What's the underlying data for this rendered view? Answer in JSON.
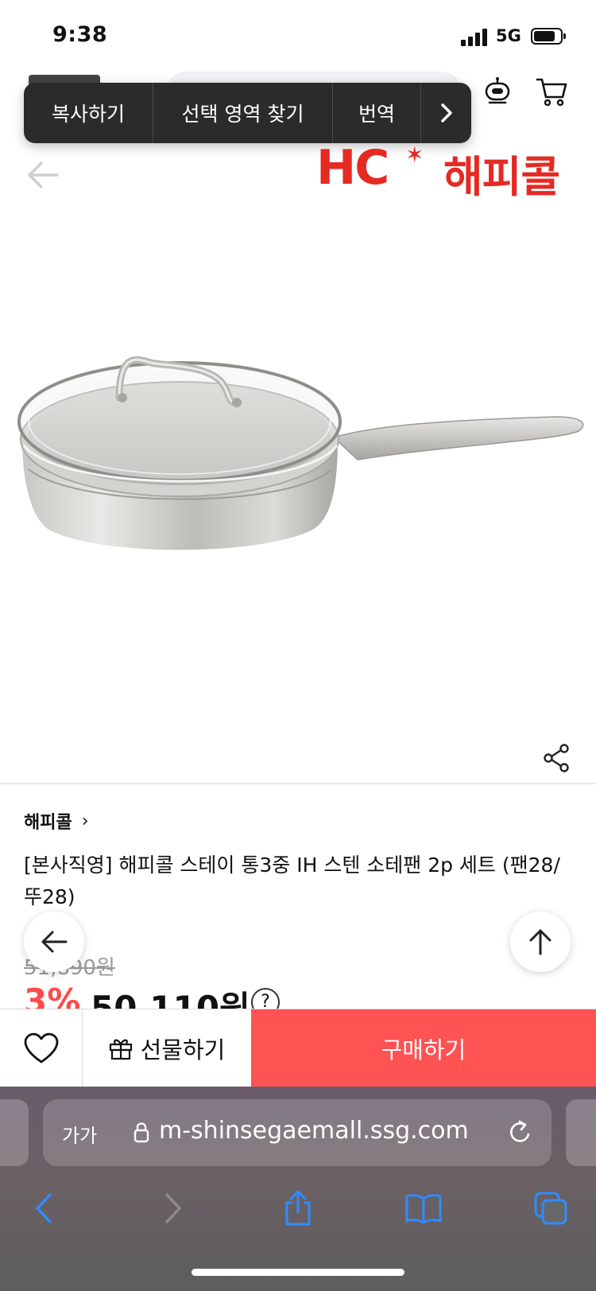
{
  "status_bar": {
    "time": "9:38",
    "network": "5G"
  },
  "edit_menu": {
    "copy": "복사하기",
    "find_in_selection": "선택 영역 찾기",
    "translate": "번역",
    "more": "›"
  },
  "brand_logo": {
    "letters": "HC",
    "name": "해피콜",
    "color": "#e52a23"
  },
  "product": {
    "brand": "해피콜",
    "brand_chevron": "›",
    "title": "[본사직영] 해피콜 스테이 통3중 IH 스텐 소테팬 2p 세트 (팬28/뚜28)",
    "original_price": "51,890원",
    "discount": "3%",
    "sale_price": "50,110원",
    "help": "?"
  },
  "actions": {
    "gift": "선물하기",
    "buy": "구매하기",
    "buy_color": "#ff5252"
  },
  "browser": {
    "text_size": "가가",
    "url": "m-shinsegaemall.ssg.com"
  },
  "icons": [
    "signal-icon",
    "battery-icon",
    "bot-icon",
    "cart-icon",
    "back-arrow-icon",
    "share-icon",
    "arrow-up-icon",
    "heart-icon",
    "gift-icon",
    "lock-icon",
    "reload-icon",
    "safari-back-icon",
    "safari-forward-icon",
    "share-sheet-icon",
    "bookmarks-icon",
    "tabs-icon"
  ]
}
